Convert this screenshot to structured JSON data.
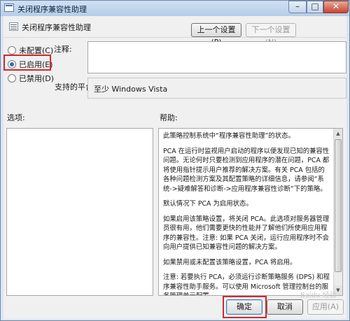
{
  "window": {
    "title": "关闭程序兼容性助理",
    "controls": {
      "minimize": "–",
      "maximize": "□",
      "close": "✕"
    }
  },
  "header": {
    "title": "关闭程序兼容性助理",
    "prev_button": "上一个设置(P)",
    "next_button": "下一个设置(N)"
  },
  "options": [
    {
      "label": "未配置(C)",
      "checked": false
    },
    {
      "label": "已启用(E)",
      "checked": true
    },
    {
      "label": "已禁用(D)",
      "checked": false
    }
  ],
  "comment_label": "注释:",
  "platform_label": "支持的平台:",
  "platform_value": "至少 Windows Vista",
  "options_label": "选项:",
  "help_label": "帮助:",
  "help_text": [
    "此策略控制系统中“程序兼容性助理”的状态。",
    "PCA 在运行时监视用户启动的程序以便发现已知的兼容性问题。无论何时只要检测到应用程序的潜在问题，PCA 都将使用指针提示用户推荐的解决方案。有关 PCA 包括的各种问题检测方案及其配置策略的详细信息，请参阅“系统->疑难解答和诊断->应用程序兼容性诊断”下的策略。",
    "默认情况下 PCA 为启用状态。",
    "如果启用该策略设置，将关闭 PCA。此选项对服务器管理员很有用，他们需要更快的性能并了解他们所使用应用程序的兼容性。注意: 如果 PCA 关闭，运行应用程序时不会向用户提供已知兼容性问题的解决方案。",
    "如果禁用或未配置该策略设置，PCA 将启用。",
    "注意: 若要执行 PCA，必须运行诊断策略服务 (DPS) 和程序兼容性助手服务。可以使用 Microsoft 管理控制台的服务管理单元配置"
  ],
  "footer": {
    "ok": "确定",
    "cancel": "取消",
    "apply": "应用(A)"
  },
  "watermark": "Baidu 经验",
  "colors": {
    "highlight_box": "#d4262d",
    "radio_checked": "#1f6fc5",
    "titlebar": "#b6cde8"
  }
}
